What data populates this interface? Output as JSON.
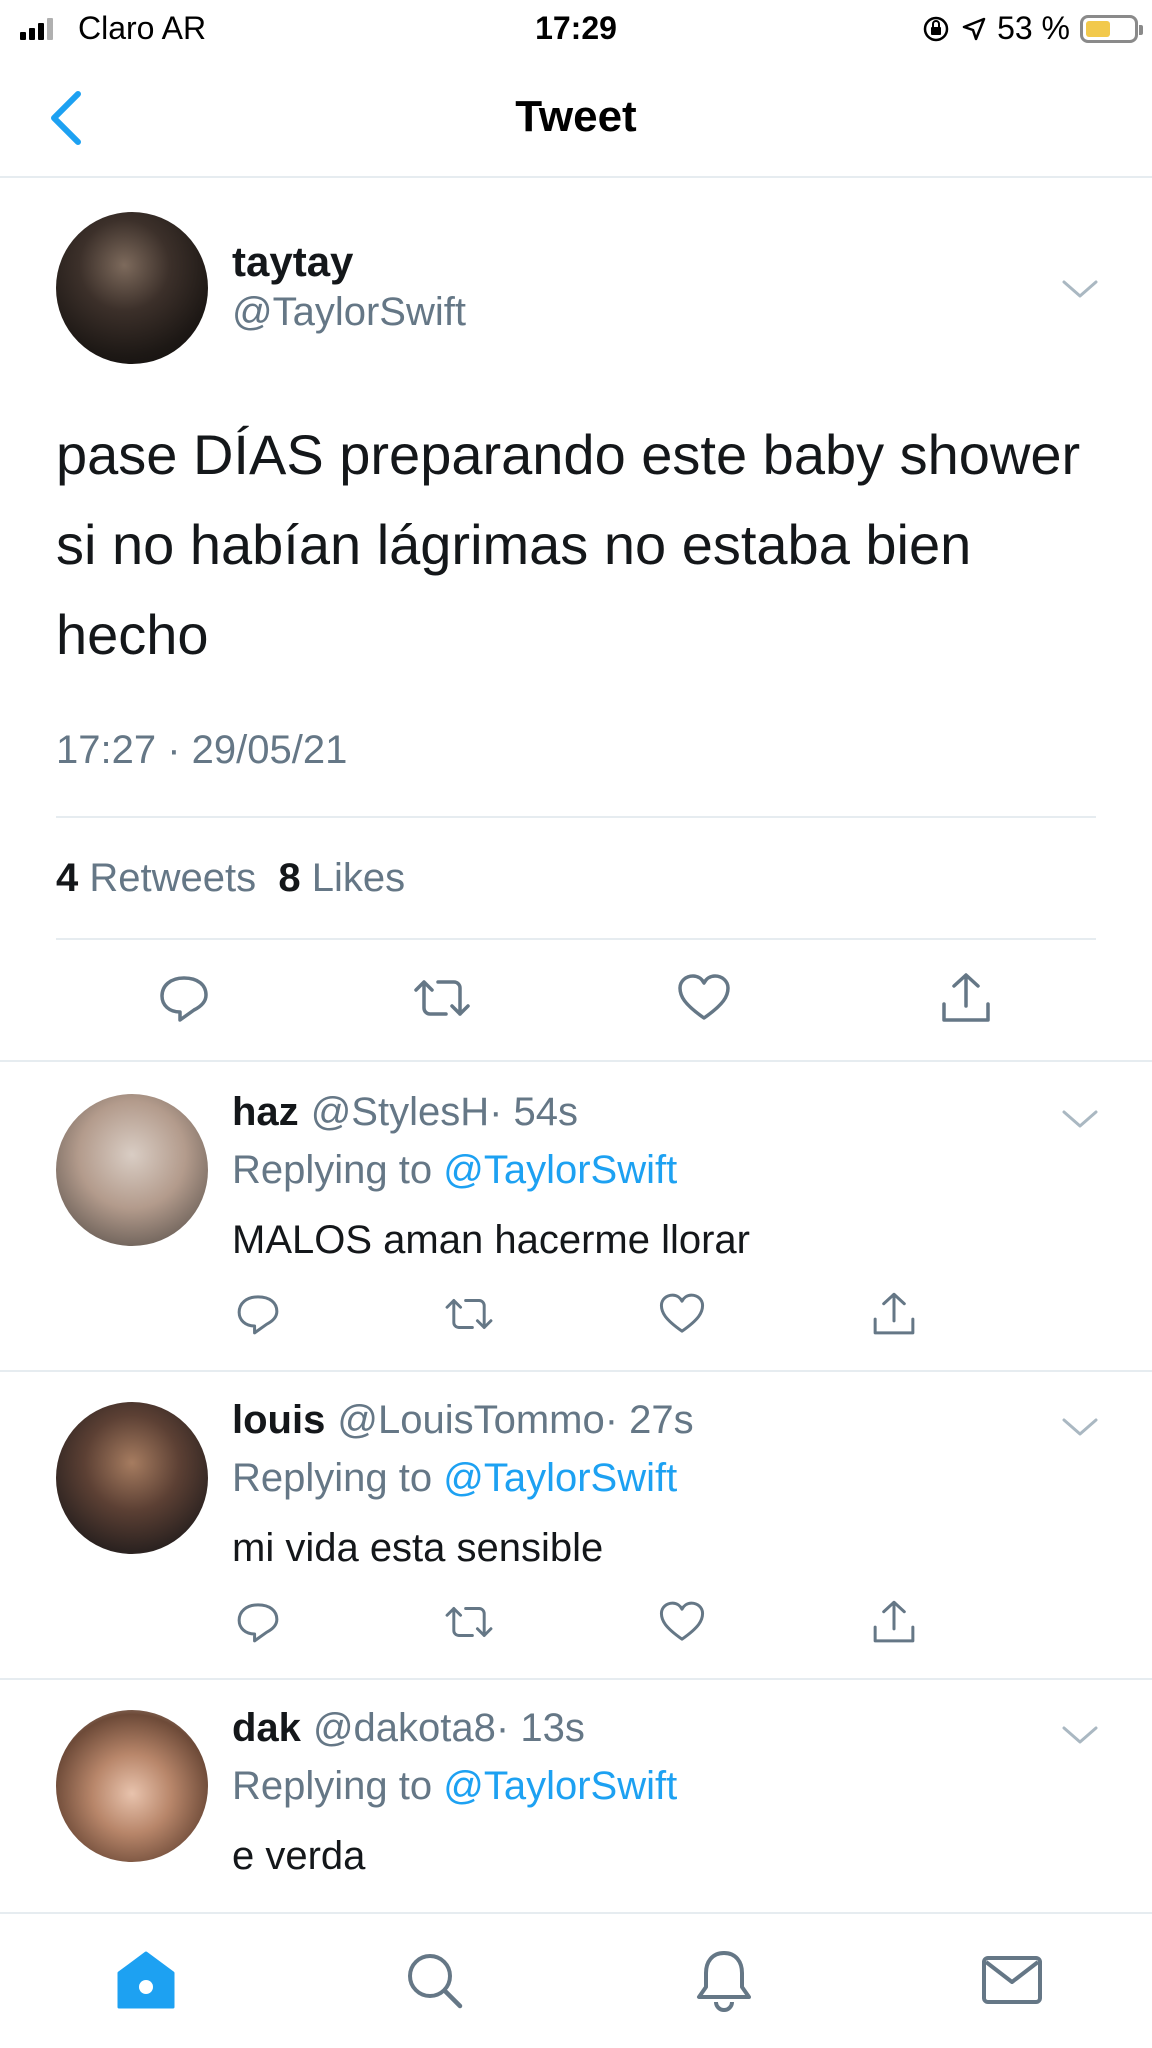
{
  "status_bar": {
    "carrier": "Claro AR",
    "time": "17:29",
    "battery": "53 %",
    "battery_level": 0.53
  },
  "header": {
    "title": "Tweet"
  },
  "main_tweet": {
    "display_name": "taytay",
    "handle": "@TaylorSwift",
    "text": "pase DÍAS preparando este baby shower si no habían lágrimas no estaba bien hecho",
    "timestamp": "17:27 · 29/05/21",
    "retweets_count": "4",
    "retweets_label": "Retweets",
    "likes_count": "8",
    "likes_label": "Likes"
  },
  "replies": [
    {
      "display_name": "haz",
      "handle": "@StylesH",
      "age": "· 54s",
      "replying_label": "Replying to",
      "replying_to": "@TaylorSwift",
      "text": "MALOS aman hacerme llorar"
    },
    {
      "display_name": "louis",
      "handle": "@LouisTommo",
      "age": "· 27s",
      "replying_label": "Replying to",
      "replying_to": "@TaylorSwift",
      "text": "mi vida esta sensible"
    },
    {
      "display_name": "dak",
      "handle": "@dakota8",
      "age": "· 13s",
      "replying_label": "Replying to",
      "replying_to": "@TaylorSwift",
      "text": "e verda"
    }
  ],
  "icons": [
    "back-arrow-icon",
    "chevron-down-icon",
    "reply-icon",
    "retweet-icon",
    "like-icon",
    "share-icon",
    "home-icon",
    "search-icon",
    "notifications-icon",
    "messages-icon"
  ],
  "colors": {
    "accent": "#1da1f2",
    "secondary_text": "#657786",
    "divider": "#e6ecf0",
    "battery": "#f2c94c"
  }
}
